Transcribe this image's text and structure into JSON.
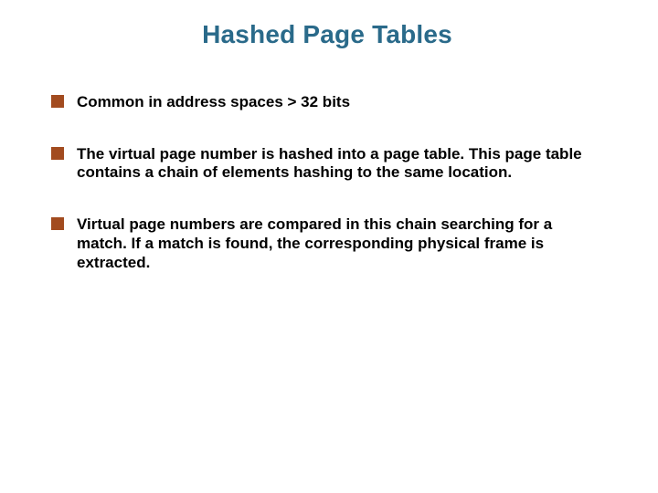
{
  "title": "Hashed Page Tables",
  "bullets": [
    {
      "text": "Common in address spaces > 32 bits"
    },
    {
      "text": "The virtual page number is hashed into a page table. This page table contains a chain of elements hashing to the same location."
    },
    {
      "text": "Virtual page numbers are compared in this chain searching for a match. If a match is found, the corresponding physical frame is extracted."
    }
  ]
}
